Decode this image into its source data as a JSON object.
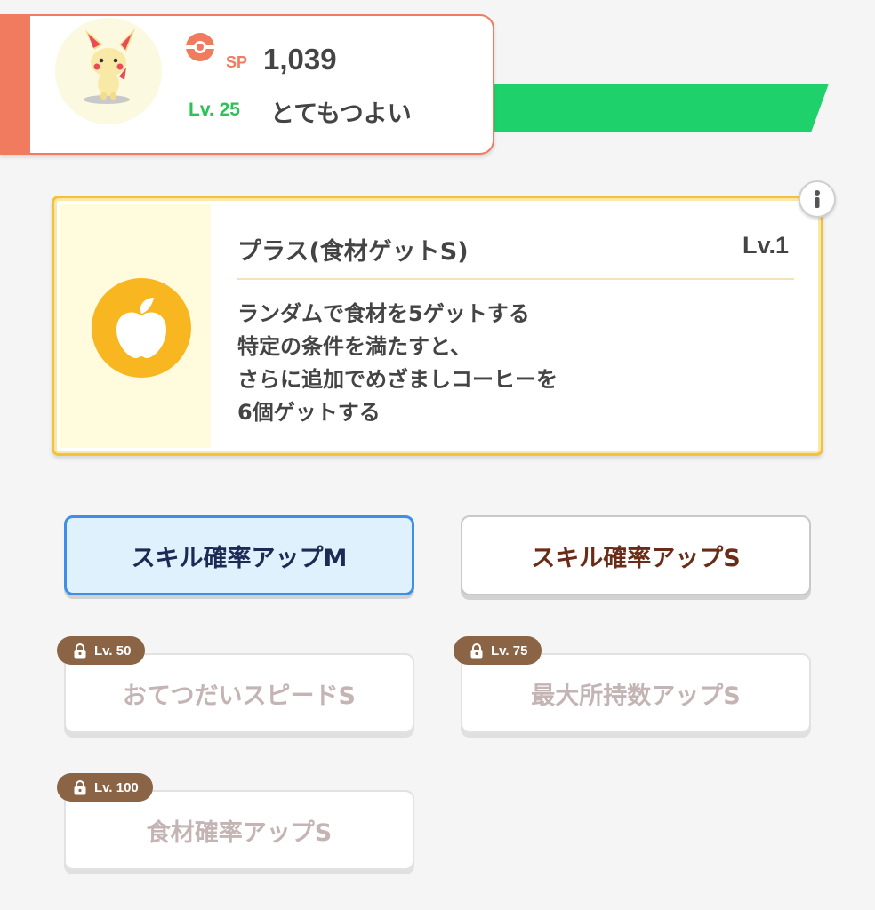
{
  "header": {
    "sp_label": "SP",
    "sp_value": "1,039",
    "level_label": "Lv. 25",
    "nature": "とてもつよい",
    "accent_color": "#f07b5f",
    "progress_color": "#1fd16a",
    "avatar_icon": "plusle-pokemon-icon"
  },
  "skill": {
    "title": "プラス(食材ゲットS)",
    "level": "Lv.1",
    "description_lines": [
      "ランダムで食材を5ゲットする",
      "特定の条件を満たすと、",
      "さらに追加でめざましコーヒーを",
      "6個ゲットする"
    ],
    "icon": "apple-icon",
    "icon_color": "#f8b620"
  },
  "sub_skills": [
    {
      "label": "スキル確率アップM",
      "state": "selected"
    },
    {
      "label": "スキル確率アップS",
      "state": "active"
    },
    {
      "label": "おてつだいスピードS",
      "state": "locked",
      "unlock": "Lv. 50"
    },
    {
      "label": "最大所持数アップS",
      "state": "locked",
      "unlock": "Lv. 75"
    },
    {
      "label": "食材確率アップS",
      "state": "locked",
      "unlock": "Lv. 100"
    }
  ]
}
